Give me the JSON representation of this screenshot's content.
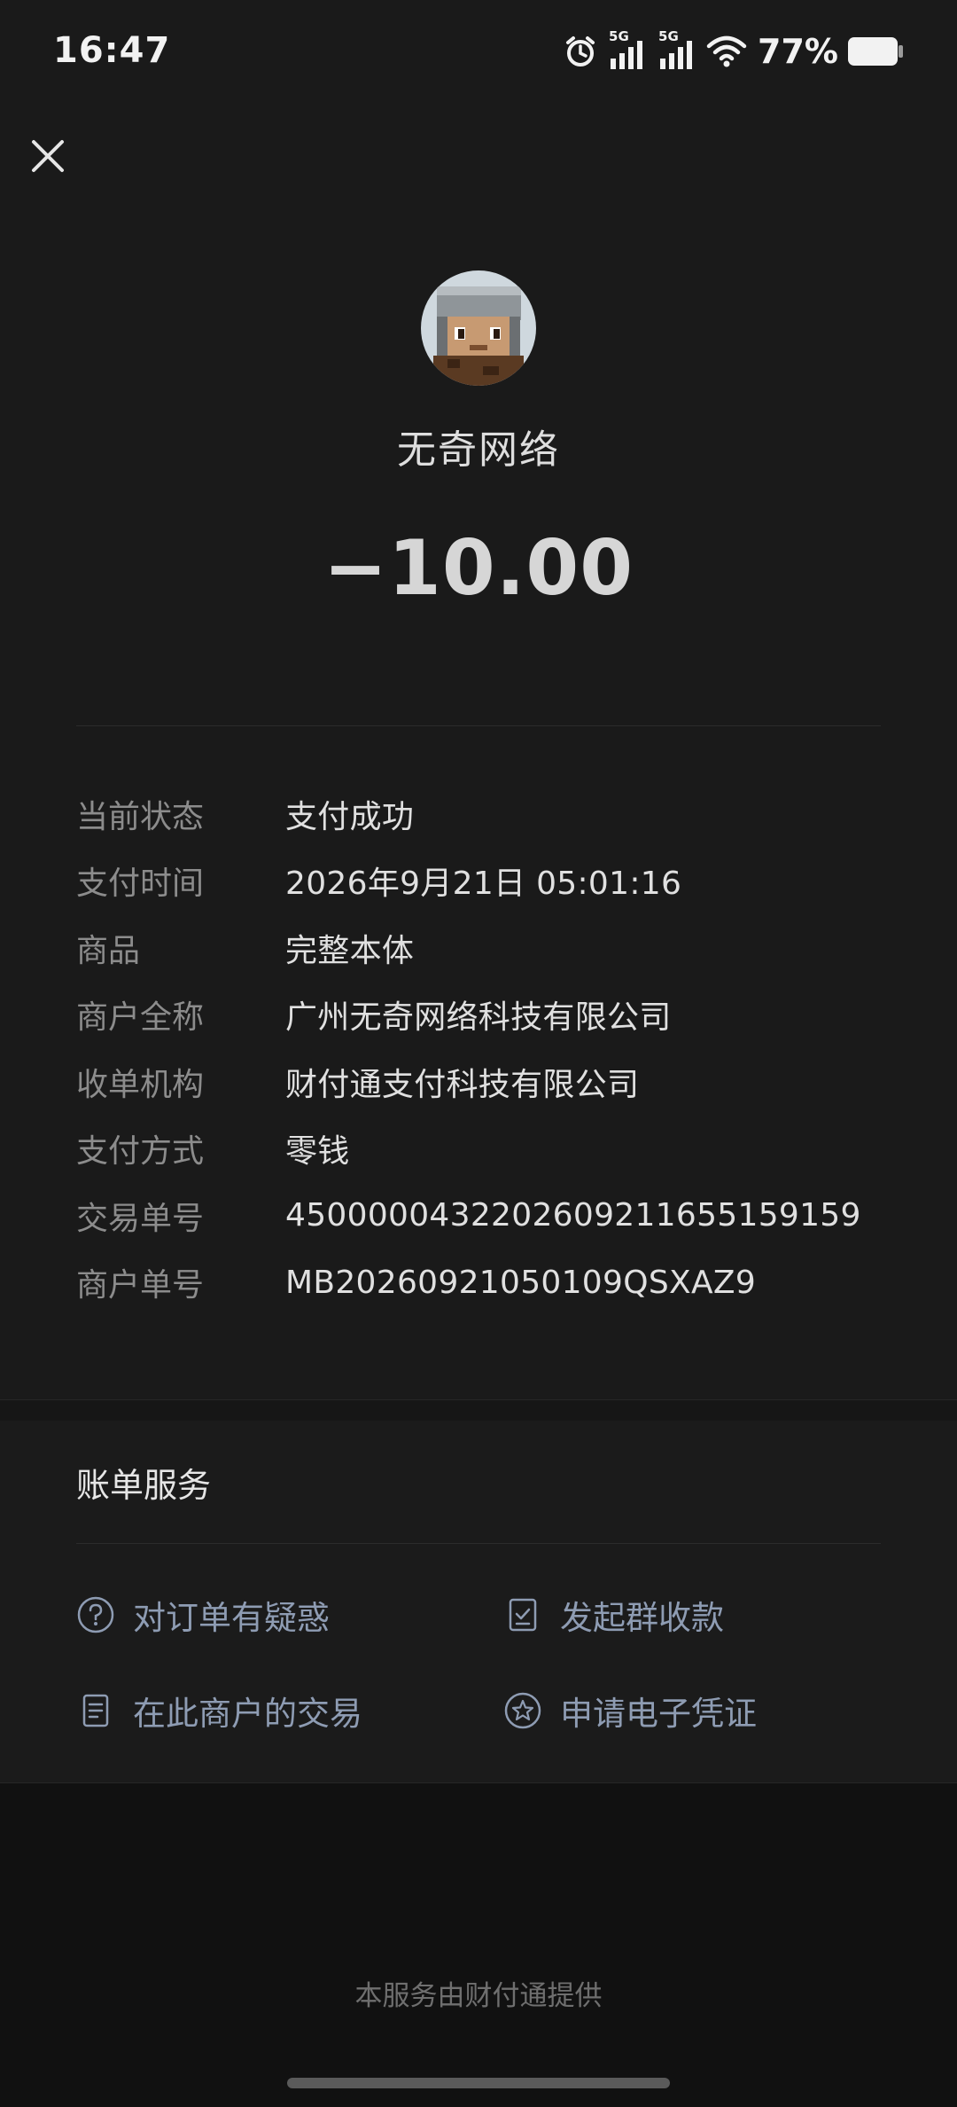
{
  "status_bar": {
    "time": "16:47",
    "battery_percent": "77%",
    "signal_1_label": "5G",
    "signal_2_label": "5G",
    "icons": [
      "alarm-icon",
      "signal-5g-icon",
      "signal-5g-icon",
      "wifi-icon",
      "battery-icon"
    ]
  },
  "merchant": {
    "name": "无奇网络",
    "amount": "−10.00"
  },
  "details": [
    {
      "label": "当前状态",
      "value": "支付成功"
    },
    {
      "label": "支付时间",
      "value": "2026年9月21日 05:01:16"
    },
    {
      "label": "商品",
      "value": "完整本体"
    },
    {
      "label": "商户全称",
      "value": "广州无奇网络科技有限公司"
    },
    {
      "label": "收单机构",
      "value": "财付通支付科技有限公司"
    },
    {
      "label": "支付方式",
      "value": "零钱"
    },
    {
      "label": "交易单号",
      "value": "4500000432202609211655159159"
    },
    {
      "label": "商户单号",
      "value": "MB20260921050109QSXAZ9"
    }
  ],
  "bill_service": {
    "title": "账单服务",
    "actions": [
      {
        "label": "对订单有疑惑",
        "icon": "question-icon"
      },
      {
        "label": "发起群收款",
        "icon": "document-check-icon"
      },
      {
        "label": "在此商户的交易",
        "icon": "receipt-icon"
      },
      {
        "label": "申请电子凭证",
        "icon": "star-badge-icon"
      }
    ]
  },
  "footer": {
    "text": "本服务由财付通提供"
  },
  "colors": {
    "background": "#1a1a1a",
    "action_text": "#8e9cb3",
    "label_text": "#8c8c8c"
  }
}
